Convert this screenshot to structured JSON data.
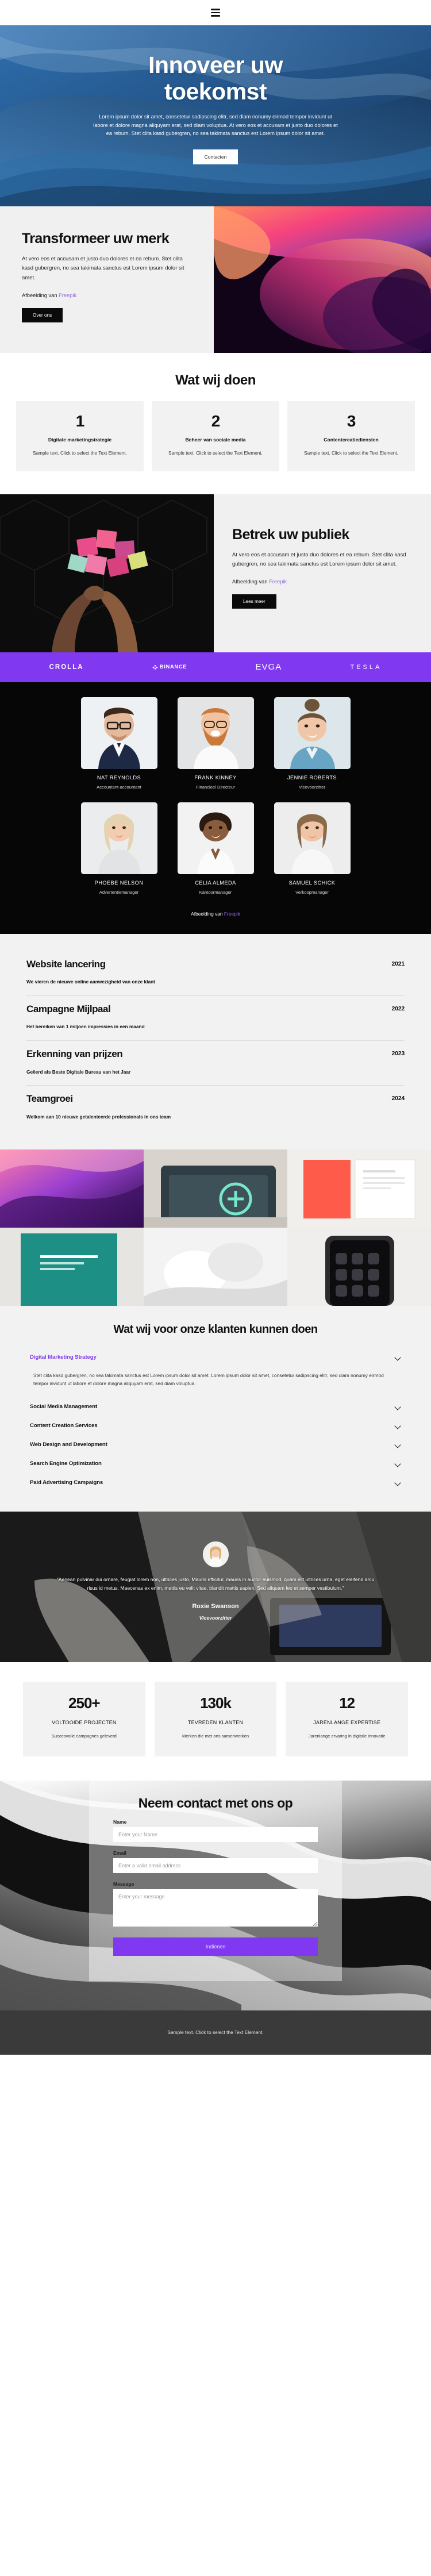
{
  "header": {
    "menu_icon": "hamburger-menu-icon"
  },
  "hero": {
    "title_line1": "Innoveer uw",
    "title_line2": "toekomst",
    "paragraph": "Lorem ipsum dolor sit amet, consetetur sadipscing elitr, sed diam nonumy eirmod tempor invidunt ut labore et dolore magna aliquyam erat, sed diam voluptua. At vero eos et accusam et justo duo dolores et ea rebum. Stet clita kasd gubergren, no sea takimata sanctus est Lorem ipsum dolor sit amet.",
    "cta_label": "Contacten"
  },
  "transform": {
    "title": "Transformeer uw merk",
    "paragraph": "At vero eos et accusam et justo duo dolores et ea rebum. Stet clita kasd gubergren, no sea takimata sanctus est Lorem ipsum dolor sit amet.",
    "credit_prefix": "Afbeelding van ",
    "credit_link": "Freepik",
    "cta_label": "Over ons"
  },
  "services": {
    "title": "Wat wij doen",
    "cards": [
      {
        "number": "1",
        "title": "Digitale marketingstrategie",
        "desc": "Sample text. Click to select the Text Element."
      },
      {
        "number": "2",
        "title": "Beheer van sociale media",
        "desc": "Sample text. Click to select the Text Element."
      },
      {
        "number": "3",
        "title": "Contentcreatiediensten",
        "desc": "Sample text. Click to select the Text Element."
      }
    ]
  },
  "engage": {
    "title": "Betrek uw publiek",
    "paragraph": "At vero eos et accusam et justo duo dolores et ea rebum. Stet clita kasd gubergren, no sea takimata sanctus est Lorem ipsum dolor sit amet.",
    "credit_prefix": "Afbeelding van ",
    "credit_link": "Freepik",
    "cta_label": "Lees meer"
  },
  "logos": [
    {
      "name": "CROLLA"
    },
    {
      "name": "BINANCE"
    },
    {
      "name": "EVGA"
    },
    {
      "name": "TESLA"
    }
  ],
  "team": {
    "credit_prefix": "Afbeelding van ",
    "credit_link": "Freepik",
    "members": [
      {
        "name": "NAT REYNOLDS",
        "role": "Accountant-accountant"
      },
      {
        "name": "FRANK KINNEY",
        "role": "Financieel Directeur"
      },
      {
        "name": "JENNIE ROBERTS",
        "role": "Vicevoorzitter"
      },
      {
        "name": "PHOEBE NELSON",
        "role": "Advertentiemanager"
      },
      {
        "name": "CELIA ALMEDA",
        "role": "Kantoormanager"
      },
      {
        "name": "SAMUEL SCHICK",
        "role": "Verkoopmanager"
      }
    ]
  },
  "timeline": [
    {
      "title": "Website lancering",
      "sub": "We vieren de nieuwe online aanwezigheid van onze klant",
      "year": "2021"
    },
    {
      "title": "Campagne Mijlpaal",
      "sub": "Het bereiken van 1 miljoen impressies in een maand",
      "year": "2022"
    },
    {
      "title": "Erkenning van prijzen",
      "sub": "Geëerd als Beste Digitale Bureau van het Jaar",
      "year": "2023"
    },
    {
      "title": "Teamgroei",
      "sub": "Welkom aan 10 nieuwe getalenteerde professionals in ons team",
      "year": "2024"
    }
  ],
  "accordion": {
    "title": "Wat wij voor onze klanten kunnen doen",
    "items": [
      {
        "label": "Digital Marketing Strategy",
        "open": true,
        "body": "Stet clita kasd gubergren, no sea takimata sanctus est Lorem ipsum dolor sit amet. Lorem ipsum dolor sit amet, consetetur sadipscing elitr, sed diam nonumy eirmod tempor invidunt ut labore et dolore magna aliquyam erat, sed diam voluptua."
      },
      {
        "label": "Social Media Management",
        "open": false,
        "body": ""
      },
      {
        "label": "Content Creation Services",
        "open": false,
        "body": ""
      },
      {
        "label": "Web Design and Development",
        "open": false,
        "body": ""
      },
      {
        "label": "Search Engine Optimization",
        "open": false,
        "body": ""
      },
      {
        "label": "Paid Advertising Campaigns",
        "open": false,
        "body": ""
      }
    ]
  },
  "testimonial": {
    "quote": "\"Aenean pulvinar dui ornare, feugiat lorem non, ultrices justo. Mauris efficitur, mauris in auctor euismod, quam elit ultrices urna, eget eleifend arcu risus id metus. Maecenas ex enim, mattis eu velit vitae, blandit mattis sapien. Sed aliquam leo et semper vestibulum.\"",
    "name": "Roxie Swanson",
    "role": "Vicevoorzitter"
  },
  "stats": [
    {
      "number": "250+",
      "label": "VOLTOOIDE PROJECTEN",
      "desc": "Succesvolle campagnes geleverd"
    },
    {
      "number": "130k",
      "label": "TEVREDEN KLANTEN",
      "desc": "Merken die met ons samenwerken"
    },
    {
      "number": "12",
      "label": "JARENLANGE EXPERTISE",
      "desc": "Jarenlange ervaring in digitale innovatie"
    }
  ],
  "contact": {
    "title": "Neem contact met ons op",
    "name_label": "Name",
    "name_placeholder": "Enter your Name",
    "name_value": "",
    "email_label": "Email",
    "email_placeholder": "Enter a valid email address",
    "email_value": "",
    "message_label": "Message",
    "message_placeholder": "Enter your message",
    "message_value": "",
    "submit_label": "Indienen"
  },
  "footer": {
    "text": "Sample text. Click to select the Text Element."
  },
  "colors": {
    "accent": "#8039f0",
    "link": "#8f6fd6",
    "dark": "#060606",
    "panel": "#f2f2f2"
  }
}
